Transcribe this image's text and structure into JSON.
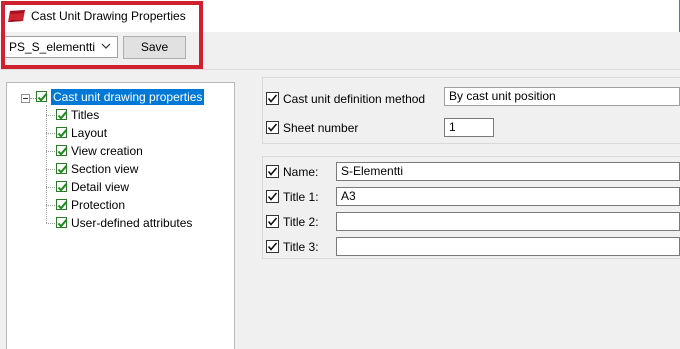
{
  "window": {
    "title": "Cast Unit Drawing Properties"
  },
  "toolbar": {
    "preset_value": "PS_S_elementti",
    "save_label": "Save"
  },
  "tree": {
    "root": {
      "label": "Cast unit drawing properties",
      "checked": true
    },
    "items": [
      {
        "label": "Titles",
        "checked": true
      },
      {
        "label": "Layout",
        "checked": true
      },
      {
        "label": "View creation",
        "checked": true
      },
      {
        "label": "Section view",
        "checked": true
      },
      {
        "label": "Detail view",
        "checked": true
      },
      {
        "label": "Protection",
        "checked": true
      },
      {
        "label": "User-defined attributes",
        "checked": true
      }
    ]
  },
  "form": {
    "definition_method": {
      "label": "Cast unit definition method",
      "value": "By cast unit position",
      "checked": true
    },
    "sheet_number": {
      "label": "Sheet number",
      "value": "1",
      "checked": true
    },
    "name": {
      "label": "Name:",
      "value": "S-Elementti",
      "checked": true
    },
    "title1": {
      "label": "Title 1:",
      "value": "A3",
      "checked": true
    },
    "title2": {
      "label": "Title 2:",
      "value": "",
      "checked": true
    },
    "title3": {
      "label": "Title 3:",
      "value": "",
      "checked": true
    }
  },
  "colors": {
    "highlight": "#d0212f",
    "selection": "#0078d7",
    "check_green": "#1e8a1e",
    "app_icon": "#d0212f"
  },
  "icons": {
    "app": "cast-unit-app-icon",
    "tree_check": "green-check-icon",
    "dropdown": "chevron-down-icon",
    "expander": "collapse-minus-icon"
  }
}
